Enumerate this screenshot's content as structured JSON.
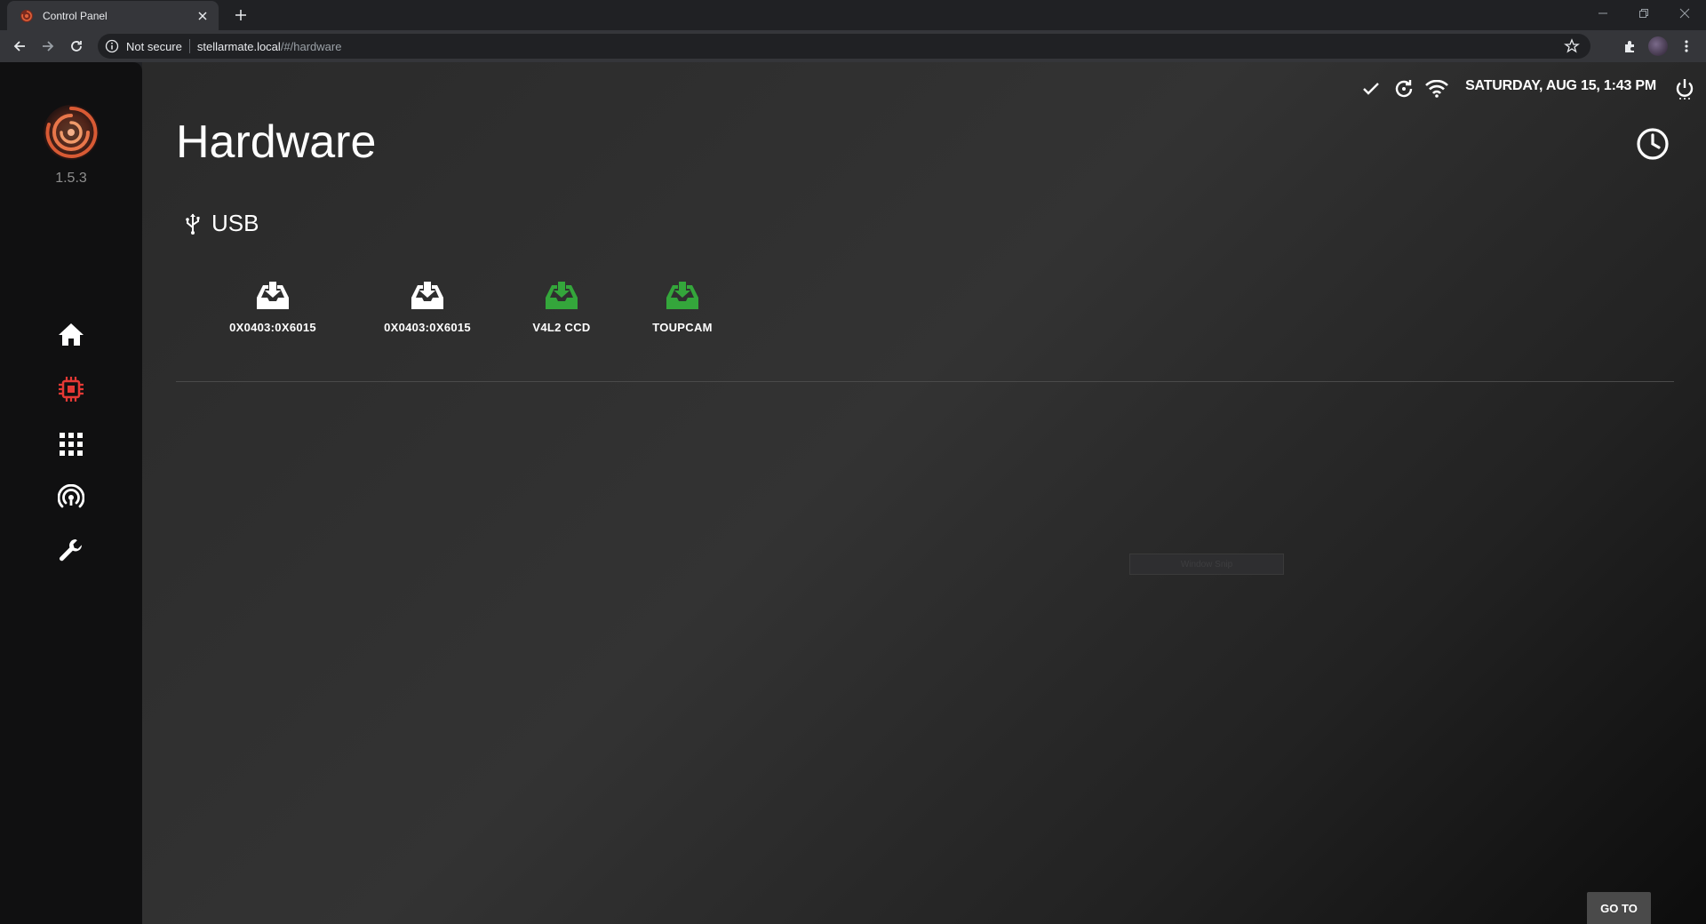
{
  "browser": {
    "tab_title": "Control Panel",
    "security_label": "Not secure",
    "url_host": "stellarmate.local",
    "url_path": "/#/hardware"
  },
  "sidebar": {
    "version": "1.5.3",
    "items": [
      {
        "name": "home",
        "icon": "home-icon",
        "active": false
      },
      {
        "name": "hardware",
        "icon": "chip-icon",
        "active": true
      },
      {
        "name": "apps",
        "icon": "grid-icon",
        "active": false
      },
      {
        "name": "network",
        "icon": "hotspot-icon",
        "active": false
      },
      {
        "name": "tools",
        "icon": "wrench-icon",
        "active": false
      }
    ],
    "active_color": "#e53935"
  },
  "status": {
    "datetime": "SATURDAY, AUG 15, 1:43 PM"
  },
  "page": {
    "title": "Hardware",
    "section": "USB"
  },
  "devices": [
    {
      "label": "0X0403:0X6015",
      "color": "#ffffff"
    },
    {
      "label": "0X0403:0X6015",
      "color": "#ffffff"
    },
    {
      "label": "V4L2 CCD",
      "color": "#34a63b"
    },
    {
      "label": "TOUPCAM",
      "color": "#34a63b"
    }
  ],
  "ghost_label": "Window Snip",
  "goto_label": "GO TO"
}
